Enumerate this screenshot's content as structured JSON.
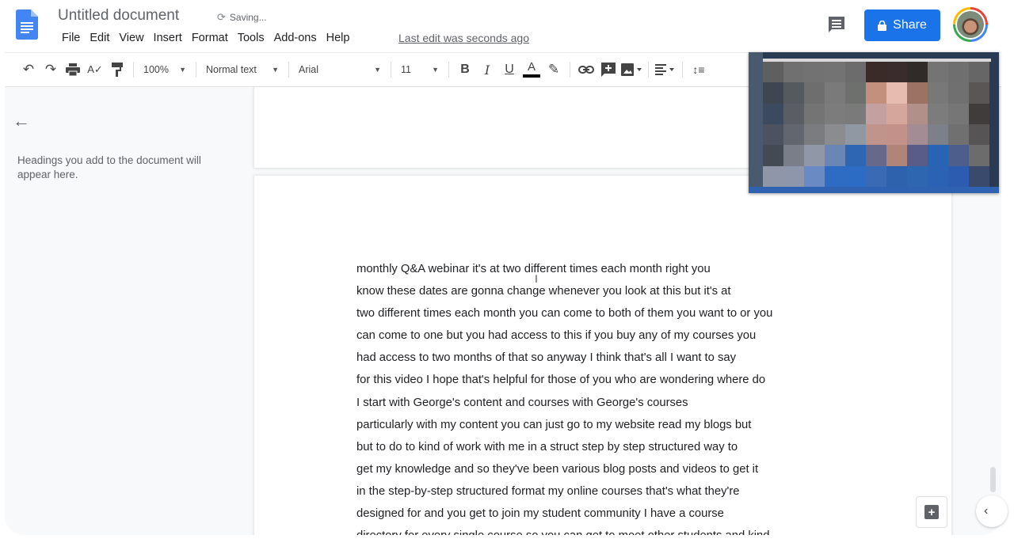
{
  "app": {
    "doc_title": "Untitled document",
    "save_status": "Saving...",
    "last_edit": "Last edit was seconds ago",
    "share_label": "Share",
    "colors": {
      "share_blue": "#1a73e8",
      "docs_blue": "#4285f4",
      "background": "#f8f9fa"
    }
  },
  "menu": [
    "File",
    "Edit",
    "View",
    "Insert",
    "Format",
    "Tools",
    "Add-ons",
    "Help"
  ],
  "toolbar": {
    "zoom": "100%",
    "style": "Normal text",
    "font": "Arial",
    "font_size": "11",
    "bold": "B",
    "italic": "I",
    "underline": "U",
    "text_color": "A",
    "icons": {
      "undo": "↶",
      "redo": "↷",
      "print": "🖶",
      "spellcheck": "A✓",
      "paint_format": "🖌",
      "highlight": "✎",
      "link": "🔗",
      "comment": "+",
      "image": "▲",
      "align": "≡",
      "line_spacing": "↕≡"
    }
  },
  "outline": {
    "back_icon": "←",
    "hint": "Headings you add to the document will appear here."
  },
  "document": {
    "lines": [
      "monthly Q&A webinar it's at two different times each month right you",
      "know these dates are gonna change whenever you look at this but it's at",
      "two different times each month you can come to both of them you want to or you",
      "can come to one but you had access to this if you buy any of my courses you",
      "had access to two months of that so anyway I think that's all I want to say",
      "for this video I hope that's helpful for those of you who are wondering where do",
      "I start with George's content and courses with George's courses",
      "particularly with my content you can just go to my website read my blogs but",
      "but to do to kind of work with me in a struct step by step structured way to",
      "get my knowledge and so they've been various blog posts and videos to get it",
      "in the step-by-step structured format my online courses that's what they're",
      "designed for and you get to join my student community I have a course",
      "directory for every single course so you can get to meet other students and kind"
    ]
  },
  "right_panel": {
    "side_toggle_icon": "‹",
    "explore_icon": "+"
  },
  "webcam": {
    "pixels": [
      [
        "#5f5f5f",
        "#707070",
        "#727272",
        "#737373",
        "#6c6c6c",
        "#3a2a28",
        "#3a2c2c",
        "#302a28",
        "#747474",
        "#6f6f6f",
        "#666666"
      ],
      [
        "#3e4652",
        "#555a5e",
        "#6e6e6e",
        "#7a7a7a",
        "#6e706e",
        "#c4907e",
        "#e6bcb0",
        "#9c7264",
        "#787878",
        "#707070",
        "#5a5656"
      ],
      [
        "#3c4a60",
        "#5a5e64",
        "#747474",
        "#7c7c7c",
        "#7a7a7a",
        "#c4a0a0",
        "#d4a69c",
        "#b09088",
        "#7c7c7c",
        "#767676",
        "#403c3c"
      ],
      [
        "#4c5260",
        "#62666e",
        "#7a7c80",
        "#8a8c90",
        "#9098a4",
        "#c0948a",
        "#c4908a",
        "#a48c94",
        "#7c8088",
        "#707070",
        "#565454"
      ],
      [
        "#444a54",
        "#7a7e88",
        "#9098a8",
        "#6a86b4",
        "#2e66b4",
        "#68688a",
        "#b08478",
        "#5a5c88",
        "#2864b4",
        "#4e5e8c",
        "#6c6c6c"
      ],
      [
        "#8e96a8",
        "#8e96ac",
        "#6a8ac4",
        "#2e6cc4",
        "#2c6cc4",
        "#3a6ab4",
        "#2e62ac",
        "#2e66b0",
        "#2c62b4",
        "#2c5cb0",
        "#3a4a6c"
      ]
    ]
  }
}
